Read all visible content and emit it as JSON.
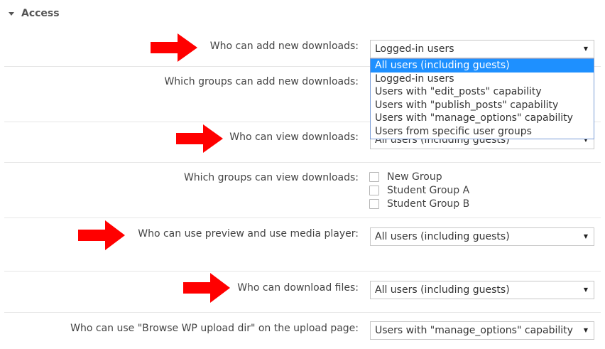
{
  "section": {
    "title": "Access"
  },
  "rows": [
    {
      "label": "Who can add new downloads:",
      "value": "Logged-in users"
    },
    {
      "label": "Which groups can add new downloads:"
    },
    {
      "label": "Who can view downloads:",
      "value": "All users (including guests)"
    },
    {
      "label": "Which groups can view downloads:"
    },
    {
      "label": "Who can use preview and use media player:",
      "value": "All users (including guests)"
    },
    {
      "label": "Who can download files:",
      "value": "All users (including guests)"
    },
    {
      "label": "Who can use \"Browse WP upload dir\" on the upload page:",
      "value": "Users with \"manage_options\" capability"
    }
  ],
  "dropdown": {
    "options": [
      "All users (including guests)",
      "Logged-in users",
      "Users with \"edit_posts\" capability",
      "Users with \"publish_posts\" capability",
      "Users with \"manage_options\" capability",
      "Users from specific user groups"
    ],
    "highlighted_index": 0
  },
  "groups": [
    "New Group",
    "Student Group A",
    "Student Group B"
  ],
  "colors": {
    "arrow": "#ff0000",
    "highlight": "#1e90ff"
  },
  "icons": {
    "arrow": "red-arrow-icon",
    "dropdown": "chevron-down-icon"
  }
}
